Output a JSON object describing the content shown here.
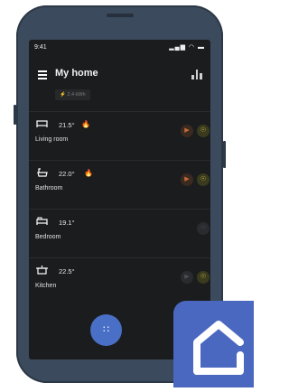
{
  "status_bar": {
    "time": "9:41",
    "icons": "▂▄▆ ◠ ▬"
  },
  "header": {
    "title": "My home",
    "energy": "⚡ 2.4 kWh"
  },
  "rooms": [
    {
      "name": "Living room",
      "temp": "21.5°",
      "heating": true
    },
    {
      "name": "Bathroom",
      "temp": "22.0°",
      "heating": true
    },
    {
      "name": "Bedroom",
      "temp": "19.1°",
      "heating": false
    },
    {
      "name": "Kitchen",
      "temp": "22.5°",
      "heating": false
    }
  ],
  "icons": {
    "flame": "🔥",
    "play": "▶",
    "bulb": "☉",
    "fab": "∷"
  }
}
